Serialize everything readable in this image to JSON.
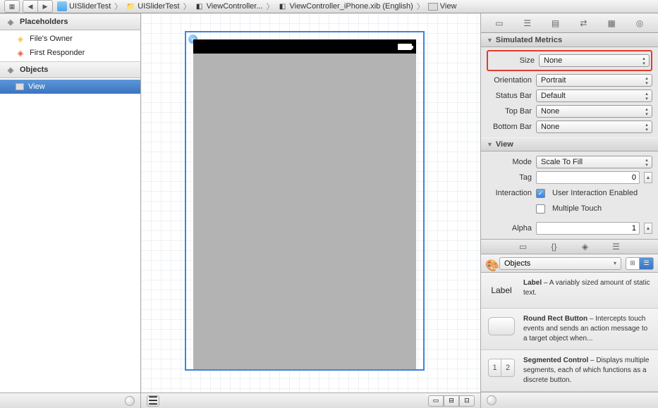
{
  "toolbar": {
    "grid_icon": "▦",
    "back": "◀",
    "fwd": "▶"
  },
  "breadcrumb": [
    {
      "icon": "blue",
      "text": "UISliderTest"
    },
    {
      "icon": "fold",
      "text": "UISliderTest"
    },
    {
      "icon": "xib",
      "text": "ViewController..."
    },
    {
      "icon": "xib",
      "text": "ViewController_iPhone.xib (English)"
    },
    {
      "icon": "view",
      "text": "View"
    }
  ],
  "outline": {
    "placeholders_hdr": "Placeholders",
    "items_ph": [
      {
        "label": "File's Owner",
        "color": "y"
      },
      {
        "label": "First Responder",
        "color": "r"
      }
    ],
    "objects_hdr": "Objects",
    "items_ob": [
      {
        "label": "View"
      }
    ]
  },
  "inspector": {
    "sim_hdr": "Simulated Metrics",
    "size_lbl": "Size",
    "size_val": "None",
    "orient_lbl": "Orientation",
    "orient_val": "Portrait",
    "status_lbl": "Status Bar",
    "status_val": "Default",
    "top_lbl": "Top Bar",
    "top_val": "None",
    "bot_lbl": "Bottom Bar",
    "bot_val": "None",
    "view_hdr": "View",
    "mode_lbl": "Mode",
    "mode_val": "Scale To Fill",
    "tag_lbl": "Tag",
    "tag_val": "0",
    "inter_lbl": "Interaction",
    "uie_lbl": "User Interaction Enabled",
    "mt_lbl": "Multiple Touch",
    "alpha_lbl": "Alpha",
    "alpha_val": "1"
  },
  "library": {
    "tabs_icons": [
      "▭",
      "{}",
      "◈",
      "☰"
    ],
    "objects_pop": "Objects",
    "items": [
      {
        "name": "Label",
        "desc": "A variably sized amount of static text.",
        "thumb": "label"
      },
      {
        "name": "Round Rect Button",
        "desc": "Intercepts touch events and sends an action message to a target object when...",
        "thumb": "btn"
      },
      {
        "name": "Segmented Control",
        "desc": "Displays multiple segments, each of which functions as a discrete button.",
        "thumb": "seg"
      }
    ]
  }
}
